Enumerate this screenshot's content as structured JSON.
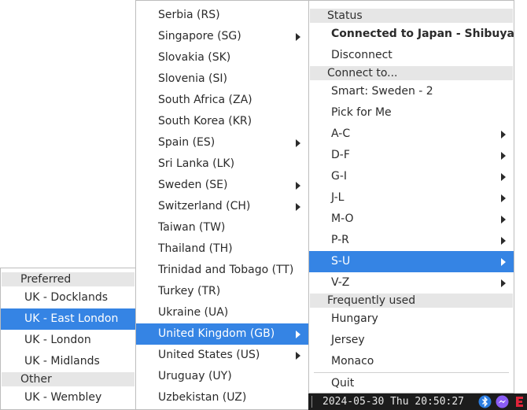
{
  "main_menu": {
    "status_header": "Status",
    "connected_label": "Connected to Japan - Shibuya",
    "disconnect_label": "Disconnect",
    "connect_header": "Connect to...",
    "items": [
      {
        "label": "Smart: Sweden - 2",
        "submenu": false
      },
      {
        "label": "Pick for Me",
        "submenu": false
      },
      {
        "label": "A-C",
        "submenu": true
      },
      {
        "label": "D-F",
        "submenu": true
      },
      {
        "label": "G-I",
        "submenu": true
      },
      {
        "label": "J-L",
        "submenu": true
      },
      {
        "label": "M-O",
        "submenu": true
      },
      {
        "label": "P-R",
        "submenu": true
      },
      {
        "label": "S-U",
        "submenu": true,
        "selected": true
      },
      {
        "label": "V-Z",
        "submenu": true
      }
    ],
    "frequent_header": "Frequently used",
    "frequent": [
      "Hungary",
      "Jersey",
      "Monaco"
    ],
    "quit_label": "Quit"
  },
  "countries_menu": {
    "items": [
      {
        "label": "Serbia (RS)",
        "submenu": false
      },
      {
        "label": "Singapore (SG)",
        "submenu": true
      },
      {
        "label": "Slovakia (SK)",
        "submenu": false
      },
      {
        "label": "Slovenia (SI)",
        "submenu": false
      },
      {
        "label": "South Africa (ZA)",
        "submenu": false
      },
      {
        "label": "South Korea (KR)",
        "submenu": false
      },
      {
        "label": "Spain (ES)",
        "submenu": true
      },
      {
        "label": "Sri Lanka (LK)",
        "submenu": false
      },
      {
        "label": "Sweden (SE)",
        "submenu": true
      },
      {
        "label": "Switzerland (CH)",
        "submenu": true
      },
      {
        "label": "Taiwan (TW)",
        "submenu": false
      },
      {
        "label": "Thailand (TH)",
        "submenu": false
      },
      {
        "label": "Trinidad and Tobago (TT)",
        "submenu": false
      },
      {
        "label": "Turkey (TR)",
        "submenu": false
      },
      {
        "label": "Ukraine (UA)",
        "submenu": false
      },
      {
        "label": "United Kingdom (GB)",
        "submenu": true,
        "selected": true
      },
      {
        "label": "United States (US)",
        "submenu": true
      },
      {
        "label": "Uruguay (UY)",
        "submenu": false
      },
      {
        "label": "Uzbekistan (UZ)",
        "submenu": false
      }
    ]
  },
  "uk_menu": {
    "preferred_header": "Preferred",
    "preferred": [
      {
        "label": "UK - Docklands"
      },
      {
        "label": "UK - East London",
        "selected": true
      },
      {
        "label": "UK - London"
      },
      {
        "label": "UK - Midlands"
      }
    ],
    "other_header": "Other",
    "other": [
      {
        "label": "UK - Wembley"
      }
    ]
  },
  "taskbar": {
    "clock": "2024-05-30 Thu 20:50:27",
    "icons": [
      "bluetooth-icon",
      "messenger-icon",
      "e-app-icon"
    ],
    "colors": {
      "bluetooth": "#2a7de1",
      "messenger": "#8a5cf6",
      "e_app": "#e0243a"
    }
  },
  "colors": {
    "selection": "#3584e4",
    "header_bg": "#e6e6e6"
  }
}
